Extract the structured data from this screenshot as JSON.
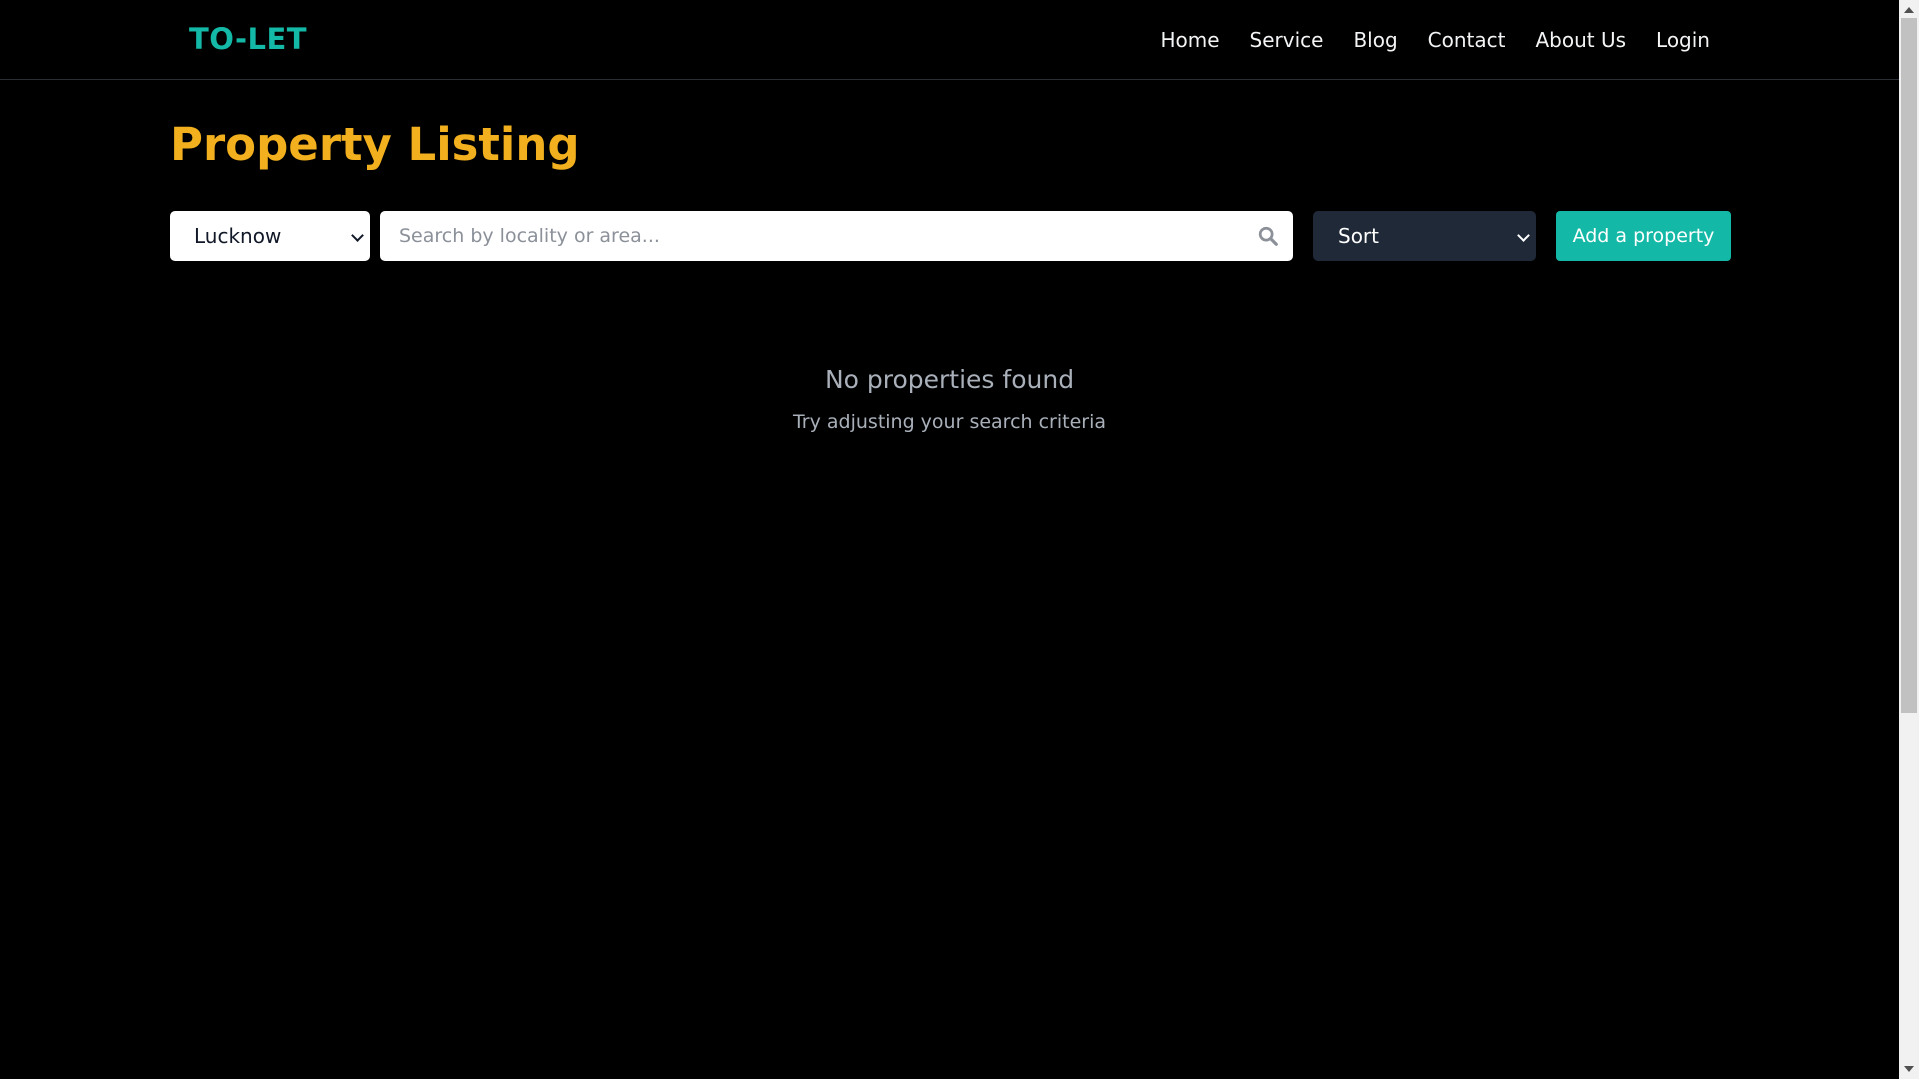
{
  "navbar": {
    "brand": "TO-LET",
    "links": [
      "Home",
      "Service",
      "Blog",
      "Contact",
      "About Us",
      "Login"
    ]
  },
  "main": {
    "title": "Property Listing",
    "city_select": {
      "value": "Lucknow"
    },
    "search": {
      "placeholder": "Search by locality or area..."
    },
    "sort_select": {
      "value": "Sort"
    },
    "add_button_label": "Add a property",
    "empty_state": {
      "title": "No properties found",
      "subtitle": "Try adjusting your search criteria"
    }
  },
  "colors": {
    "background": "#000000",
    "brand": "#14b8a6",
    "title": "#f2b01e",
    "sort_bg": "#1f2937",
    "muted_text": "#a9b0ba"
  },
  "icons": [
    "search-icon",
    "chevron-down-icon"
  ]
}
